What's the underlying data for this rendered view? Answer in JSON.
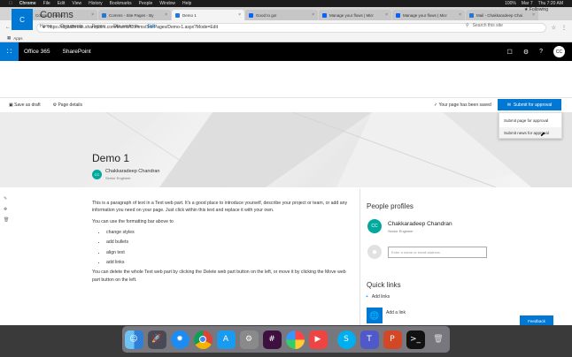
{
  "menubar": {
    "items": [
      "Chrome",
      "File",
      "Edit",
      "View",
      "History",
      "Bookmarks",
      "People",
      "Window",
      "Help"
    ],
    "battery": "100%",
    "date": "Mar 7",
    "clock": "Thu 7:20 AM"
  },
  "tabs": [
    {
      "title": "Comms - Home",
      "active": false
    },
    {
      "title": "Comms - Site Pages - By",
      "active": false
    },
    {
      "title": "Demo 1",
      "active": true
    },
    {
      "title": "Good to go!",
      "active": false
    },
    {
      "title": "Manage your flows | Micr",
      "active": false
    },
    {
      "title": "Manage your flows | Micr",
      "active": false
    },
    {
      "title": "Mail - Chakkaradeep Chai",
      "active": false
    }
  ],
  "address": {
    "url": "https://digitalbreak.sharepoint.com/teams/Comms/SitePages/Demo-1.aspx?Mode=Edit",
    "bookmarks_label": "Apps"
  },
  "suitebar": {
    "app": "Office 365",
    "product": "SharePoint",
    "user_initials": "CC"
  },
  "site": {
    "logo_letter": "C",
    "title": "Comms",
    "nav": [
      "Home",
      "Documents",
      "Pages",
      "Site contents"
    ],
    "nav_edit": "Edit",
    "following": "Following",
    "search_placeholder": "Search this site"
  },
  "commandbar": {
    "save_draft": "Save as draft",
    "page_details": "Page details",
    "status": "Your page has been saved",
    "submit": "Submit for approval",
    "dropdown": [
      "Submit page for approval",
      "Submit news for approval"
    ]
  },
  "page": {
    "title": "Demo 1",
    "author_initials": "CC",
    "author_name": "Chakkaradeep Chandran",
    "author_role": "Senior Engineer"
  },
  "text_part": {
    "para1": "This is a paragraph of text in a Text web part. It's a good place to introduce yourself, describe your project or team, or add any information you need on your page. Just click within this text and replace it with your own.",
    "para2": "You can use the formatting bar above to",
    "bullets": [
      "change styles",
      "add bullets",
      "align text",
      "add links"
    ],
    "para3": "You can delete the whole Text web part by clicking the Delete web part button on the left, or move it by clicking the Move web part button on the left."
  },
  "people_profiles": {
    "title": "People profiles",
    "person_initials": "CC",
    "person_name": "Chakkaradeep Chandran",
    "person_role": "Senior Engineer",
    "input_placeholder": "Enter a name or email address"
  },
  "quick_links": {
    "title": "Quick links",
    "add_links": "Add links",
    "add_a_link": "Add a link"
  },
  "feedback": "Feedback",
  "colors": {
    "accent": "#0078d4",
    "suitebar": "#000000",
    "avatar": "#00a99d"
  }
}
